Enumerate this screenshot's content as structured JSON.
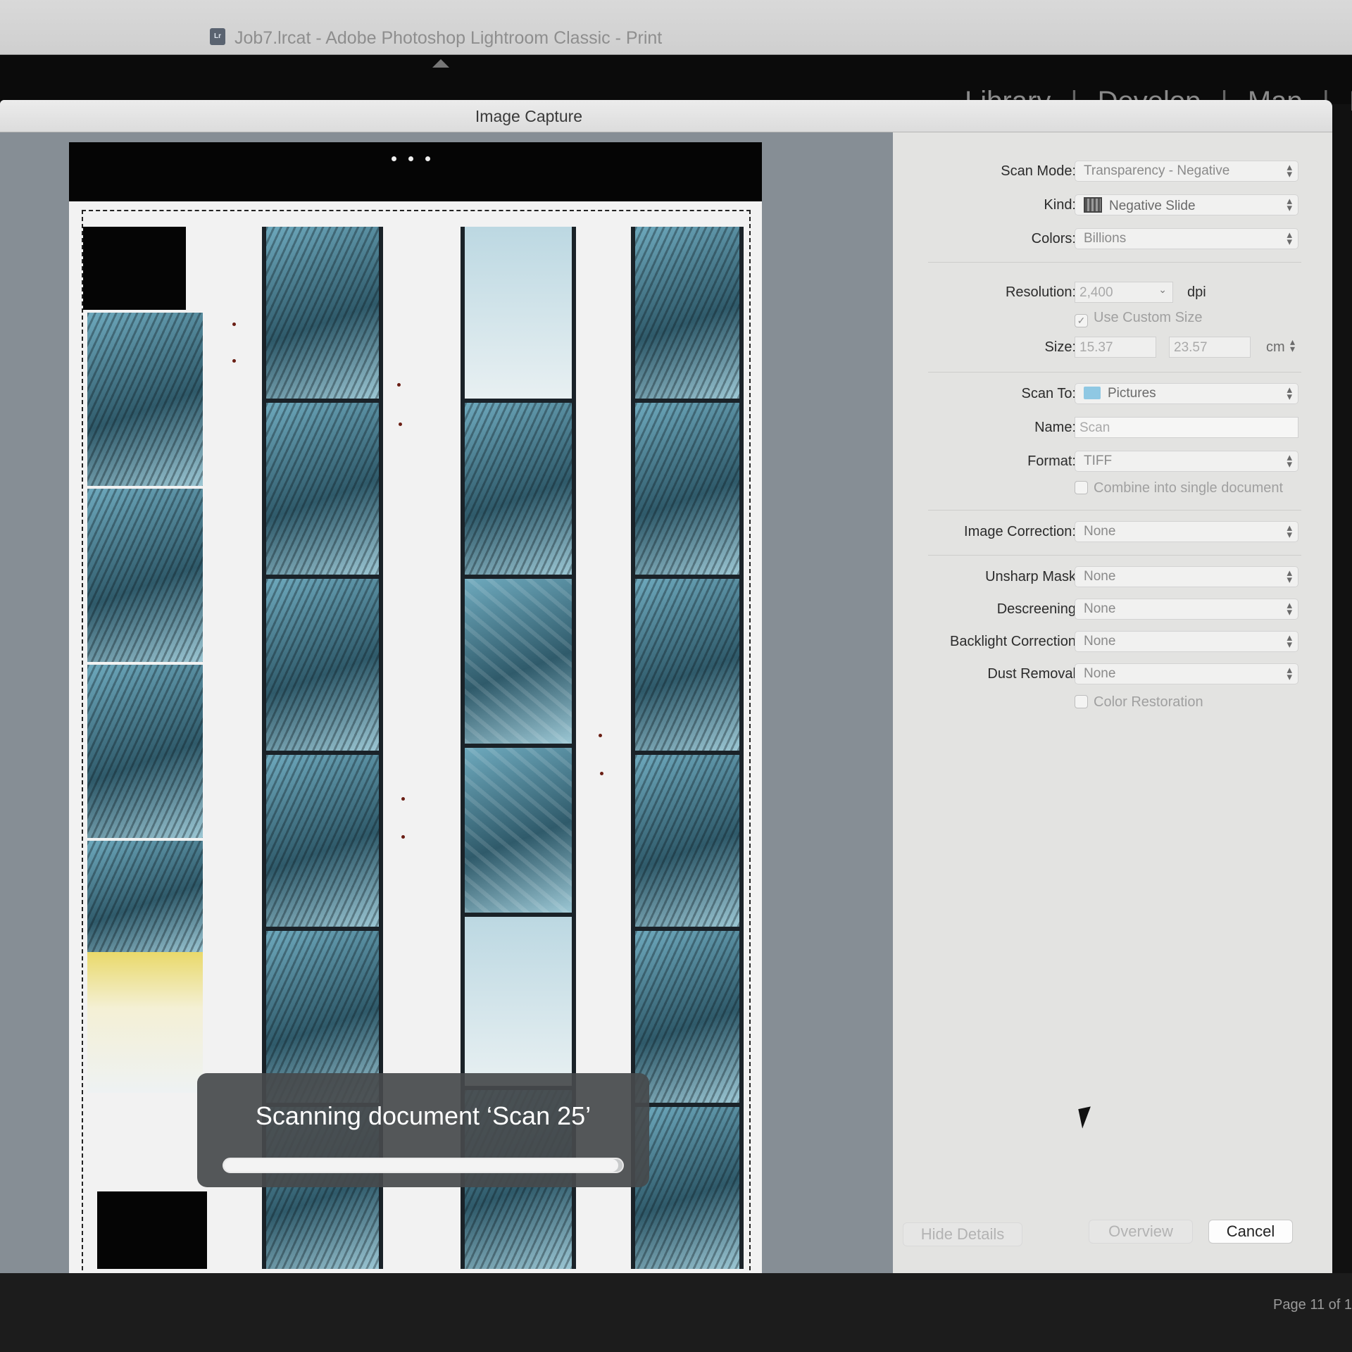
{
  "lightroom": {
    "window_title": "Job7.lrcat - Adobe Photoshop Lightroom Classic - Print",
    "app_icon_text": "Lr",
    "modules": [
      "Library",
      "Develop",
      "Map",
      "Bo"
    ],
    "page_info": "Page 11 of 1"
  },
  "image_capture": {
    "window_title": "Image Capture",
    "hud": {
      "message": "Scanning document ‘Scan 25’",
      "progress": 0.99
    },
    "settings": {
      "scan_mode": {
        "label": "Scan Mode:",
        "value": "Transparency - Negative"
      },
      "kind": {
        "label": "Kind:",
        "value": "Negative Slide",
        "icon": "negative-slide-icon"
      },
      "colors": {
        "label": "Colors:",
        "value": "Billions"
      },
      "resolution": {
        "label": "Resolution:",
        "value": "2,400",
        "unit": "dpi"
      },
      "use_custom_size": {
        "label": "Use Custom Size",
        "checked": true
      },
      "size": {
        "label": "Size:",
        "width": "15.37",
        "height": "23.57",
        "unit": "cm"
      },
      "scan_to": {
        "label": "Scan To:",
        "value": "Pictures",
        "icon": "folder-icon"
      },
      "name": {
        "label": "Name:",
        "placeholder": "Scan"
      },
      "format": {
        "label": "Format:",
        "value": "TIFF"
      },
      "combine": {
        "label": "Combine into single document",
        "checked": false
      },
      "image_correction": {
        "label": "Image Correction:",
        "value": "None"
      },
      "unsharp_mask": {
        "label": "Unsharp Mask",
        "value": "None"
      },
      "descreening": {
        "label": "Descreening",
        "value": "None"
      },
      "backlight_correction": {
        "label": "Backlight Correction",
        "value": "None"
      },
      "dust_removal": {
        "label": "Dust Removal",
        "value": "None"
      },
      "color_restoration": {
        "label": "Color Restoration",
        "checked": false
      }
    },
    "buttons": {
      "hide_details": "Hide Details",
      "overview": "Overview",
      "cancel": "Cancel"
    }
  },
  "colors": {
    "panel_bg": "#e3e3e1",
    "preview_bg": "#868e95",
    "hud_bg": "#464a4c"
  }
}
